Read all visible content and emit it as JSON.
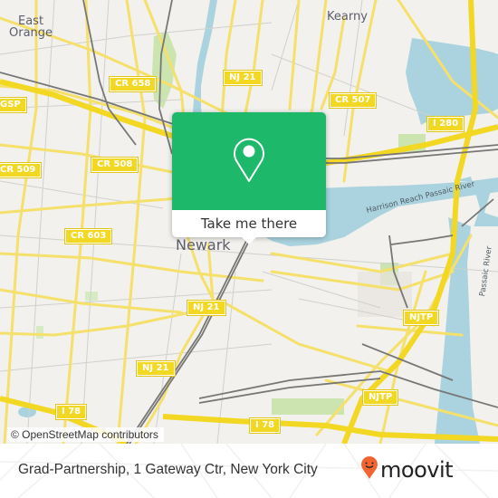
{
  "map": {
    "places": [
      {
        "id": "east-orange",
        "lines": [
          "East",
          "Orange"
        ]
      },
      {
        "id": "kearny",
        "label": "Kearny"
      },
      {
        "id": "newark",
        "label": "Newark"
      }
    ],
    "shields": [
      {
        "id": "cr-658",
        "label": "CR 658"
      },
      {
        "id": "nj-21-north",
        "label": "NJ 21"
      },
      {
        "id": "cr-507",
        "label": "CR 507"
      },
      {
        "id": "gsp",
        "label": "GSP"
      },
      {
        "id": "i-280",
        "label": "I 280"
      },
      {
        "id": "cr-509",
        "label": "CR 509"
      },
      {
        "id": "cr-508",
        "label": "CR 508"
      },
      {
        "id": "cr-603",
        "label": "CR 603"
      },
      {
        "id": "nj-21-mid",
        "label": "NJ 21"
      },
      {
        "id": "njtp-upper",
        "label": "NJTP"
      },
      {
        "id": "nj-21-south",
        "label": "NJ 21"
      },
      {
        "id": "njtp-lower",
        "label": "NJTP"
      },
      {
        "id": "i-78-west",
        "label": "I 78"
      },
      {
        "id": "i-78-east",
        "label": "I 78"
      }
    ],
    "water_labels": [
      {
        "id": "harrison-reach",
        "label": "Harrison Reach Passaic River"
      },
      {
        "id": "passaic-river",
        "label": "Passaic River"
      }
    ],
    "attribution": "© OpenStreetMap contributors",
    "colors": {
      "land": "#f2f1ed",
      "road": "#f5e06b",
      "water": "#aad3df",
      "park": "#cce5b0",
      "rail": "#777777"
    }
  },
  "popup": {
    "icon": "map-pin-icon",
    "button_label": "Take me there",
    "color": "#1db86a"
  },
  "footer": {
    "title": "Grad-Partnership, 1 Gateway Ctr, New York City",
    "logo_text": "moovit",
    "logo_color": "#f26533"
  }
}
